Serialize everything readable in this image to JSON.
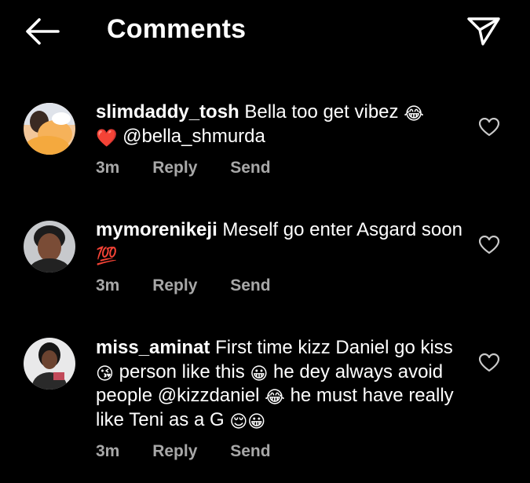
{
  "header": {
    "title": "Comments"
  },
  "comments": [
    {
      "username": "slimdaddy_tosh",
      "text_1": "Bella too get vibez",
      "emoji_1": "😂",
      "emoji_2": "❤️",
      "mention": "@bella_shmurda",
      "time": "3m",
      "reply_label": "Reply",
      "send_label": "Send"
    },
    {
      "username": "mymorenikeji",
      "text_1": "Meself go enter Asgard soon",
      "emoji_1": "💯",
      "time": "3m",
      "reply_label": "Reply",
      "send_label": "Send"
    },
    {
      "username": "miss_aminat",
      "text_1": "First time kizz Daniel go kiss",
      "emoji_1": "😘",
      "text_2": "person like this",
      "emoji_2": "😀",
      "text_3": "he dey always avoid people",
      "mention": "@kizzdaniel",
      "emoji_3": "😂",
      "text_4": "he must have really like Teni  as a G",
      "emoji_4": "😌",
      "emoji_5": "😀",
      "time": "3m",
      "reply_label": "Reply",
      "send_label": "Send"
    }
  ],
  "icons": {
    "back": "arrow-left-icon",
    "direct": "paper-plane-icon",
    "like": "heart-outline-icon"
  },
  "colors": {
    "background": "#000000",
    "text": "#ffffff",
    "meta": "#a8a8a8"
  }
}
